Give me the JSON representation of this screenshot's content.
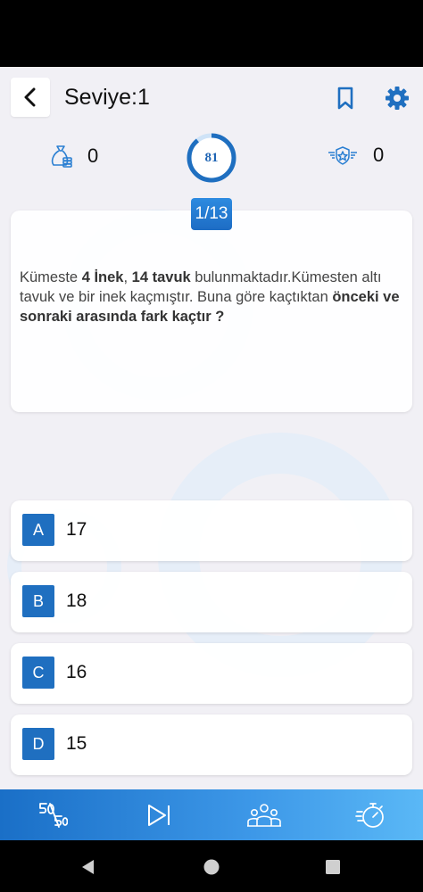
{
  "header": {
    "title": "Seviye:1"
  },
  "stats": {
    "coins": "0",
    "timer": "81",
    "badges": "0"
  },
  "question": {
    "counter": "1/13",
    "parts": [
      {
        "text": "Kümeste ",
        "bold": false
      },
      {
        "text": "4 İnek",
        "bold": true
      },
      {
        "text": ", ",
        "bold": false
      },
      {
        "text": "14 tavuk",
        "bold": true
      },
      {
        "text": " bulunmaktadır.Kümesten altı tavuk ve bir inek kaçmıştır. Buna göre kaçtıktan ",
        "bold": false
      },
      {
        "text": "önceki ve sonraki arasında fark kaçtır ?",
        "bold": true
      }
    ]
  },
  "answers": [
    {
      "letter": "A",
      "value": "17"
    },
    {
      "letter": "B",
      "value": "18"
    },
    {
      "letter": "C",
      "value": "16"
    },
    {
      "letter": "D",
      "value": "15"
    }
  ],
  "toolbar": {
    "items": [
      {
        "icon": "fifty-fifty-icon"
      },
      {
        "icon": "skip-icon"
      },
      {
        "icon": "audience-icon"
      },
      {
        "icon": "extra-time-icon"
      }
    ]
  },
  "colors": {
    "primary": "#1f6fc0",
    "accent_light": "#5ab8f6",
    "background": "#f1f0f5"
  }
}
